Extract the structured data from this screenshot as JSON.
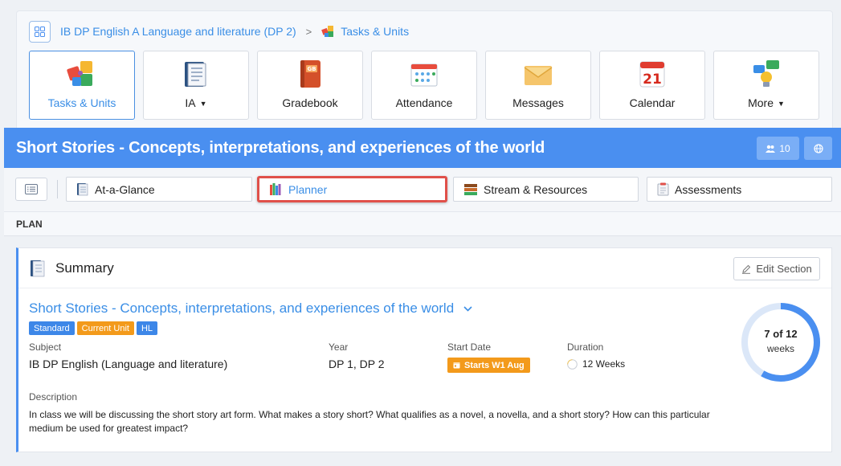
{
  "breadcrumb": {
    "course": "IB DP English A Language and literature (DP 2)",
    "separator": ">",
    "current": "Tasks & Units"
  },
  "tiles": [
    {
      "label": "Tasks & Units",
      "icon": "puzzle-icon",
      "active": true
    },
    {
      "label": "IA",
      "icon": "notebook-icon",
      "dropdown": true
    },
    {
      "label": "Gradebook",
      "icon": "gradebook-icon"
    },
    {
      "label": "Attendance",
      "icon": "attendance-calendar-icon"
    },
    {
      "label": "Messages",
      "icon": "envelope-icon"
    },
    {
      "label": "Calendar",
      "icon": "calendar-icon",
      "calendar_day": "21"
    },
    {
      "label": "More",
      "icon": "people-chat-icon",
      "dropdown": true
    }
  ],
  "header": {
    "title": "Short Stories - Concepts, interpretations, and experiences of the world",
    "member_count": "10",
    "color": "#4a8ff0"
  },
  "tabs": [
    {
      "label": "At-a-Glance",
      "icon": "notebook-icon"
    },
    {
      "label": "Planner",
      "icon": "books-icon",
      "selected": true
    },
    {
      "label": "Stream & Resources",
      "icon": "stack-icon"
    },
    {
      "label": "Assessments",
      "icon": "clipboard-icon"
    }
  ],
  "section_label": "PLAN",
  "summary": {
    "heading": "Summary",
    "edit_label": "Edit Section",
    "unit_title": "Short Stories - Concepts, interpretations, and experiences of the world",
    "badges": [
      {
        "text": "Standard",
        "color": "#3d87e8"
      },
      {
        "text": "Current Unit",
        "color": "#f39a1b"
      },
      {
        "text": "HL",
        "color": "#3d87e8"
      }
    ],
    "subject_label": "Subject",
    "subject": "IB DP English (Language and literature)",
    "year_label": "Year",
    "year": "DP 1, DP 2",
    "start_label": "Start Date",
    "start": "Starts W1 Aug",
    "duration_label": "Duration",
    "duration": "12 Weeks",
    "description_label": "Description",
    "description": "In class we will be discussing the short story art form. What makes a story short? What qualifies as a novel, a novella, and a short story? How can this particular medium be used for greatest impact?",
    "progress_text": "7 of 12",
    "progress_unit": "weeks",
    "progress_fraction": 0.5833
  }
}
